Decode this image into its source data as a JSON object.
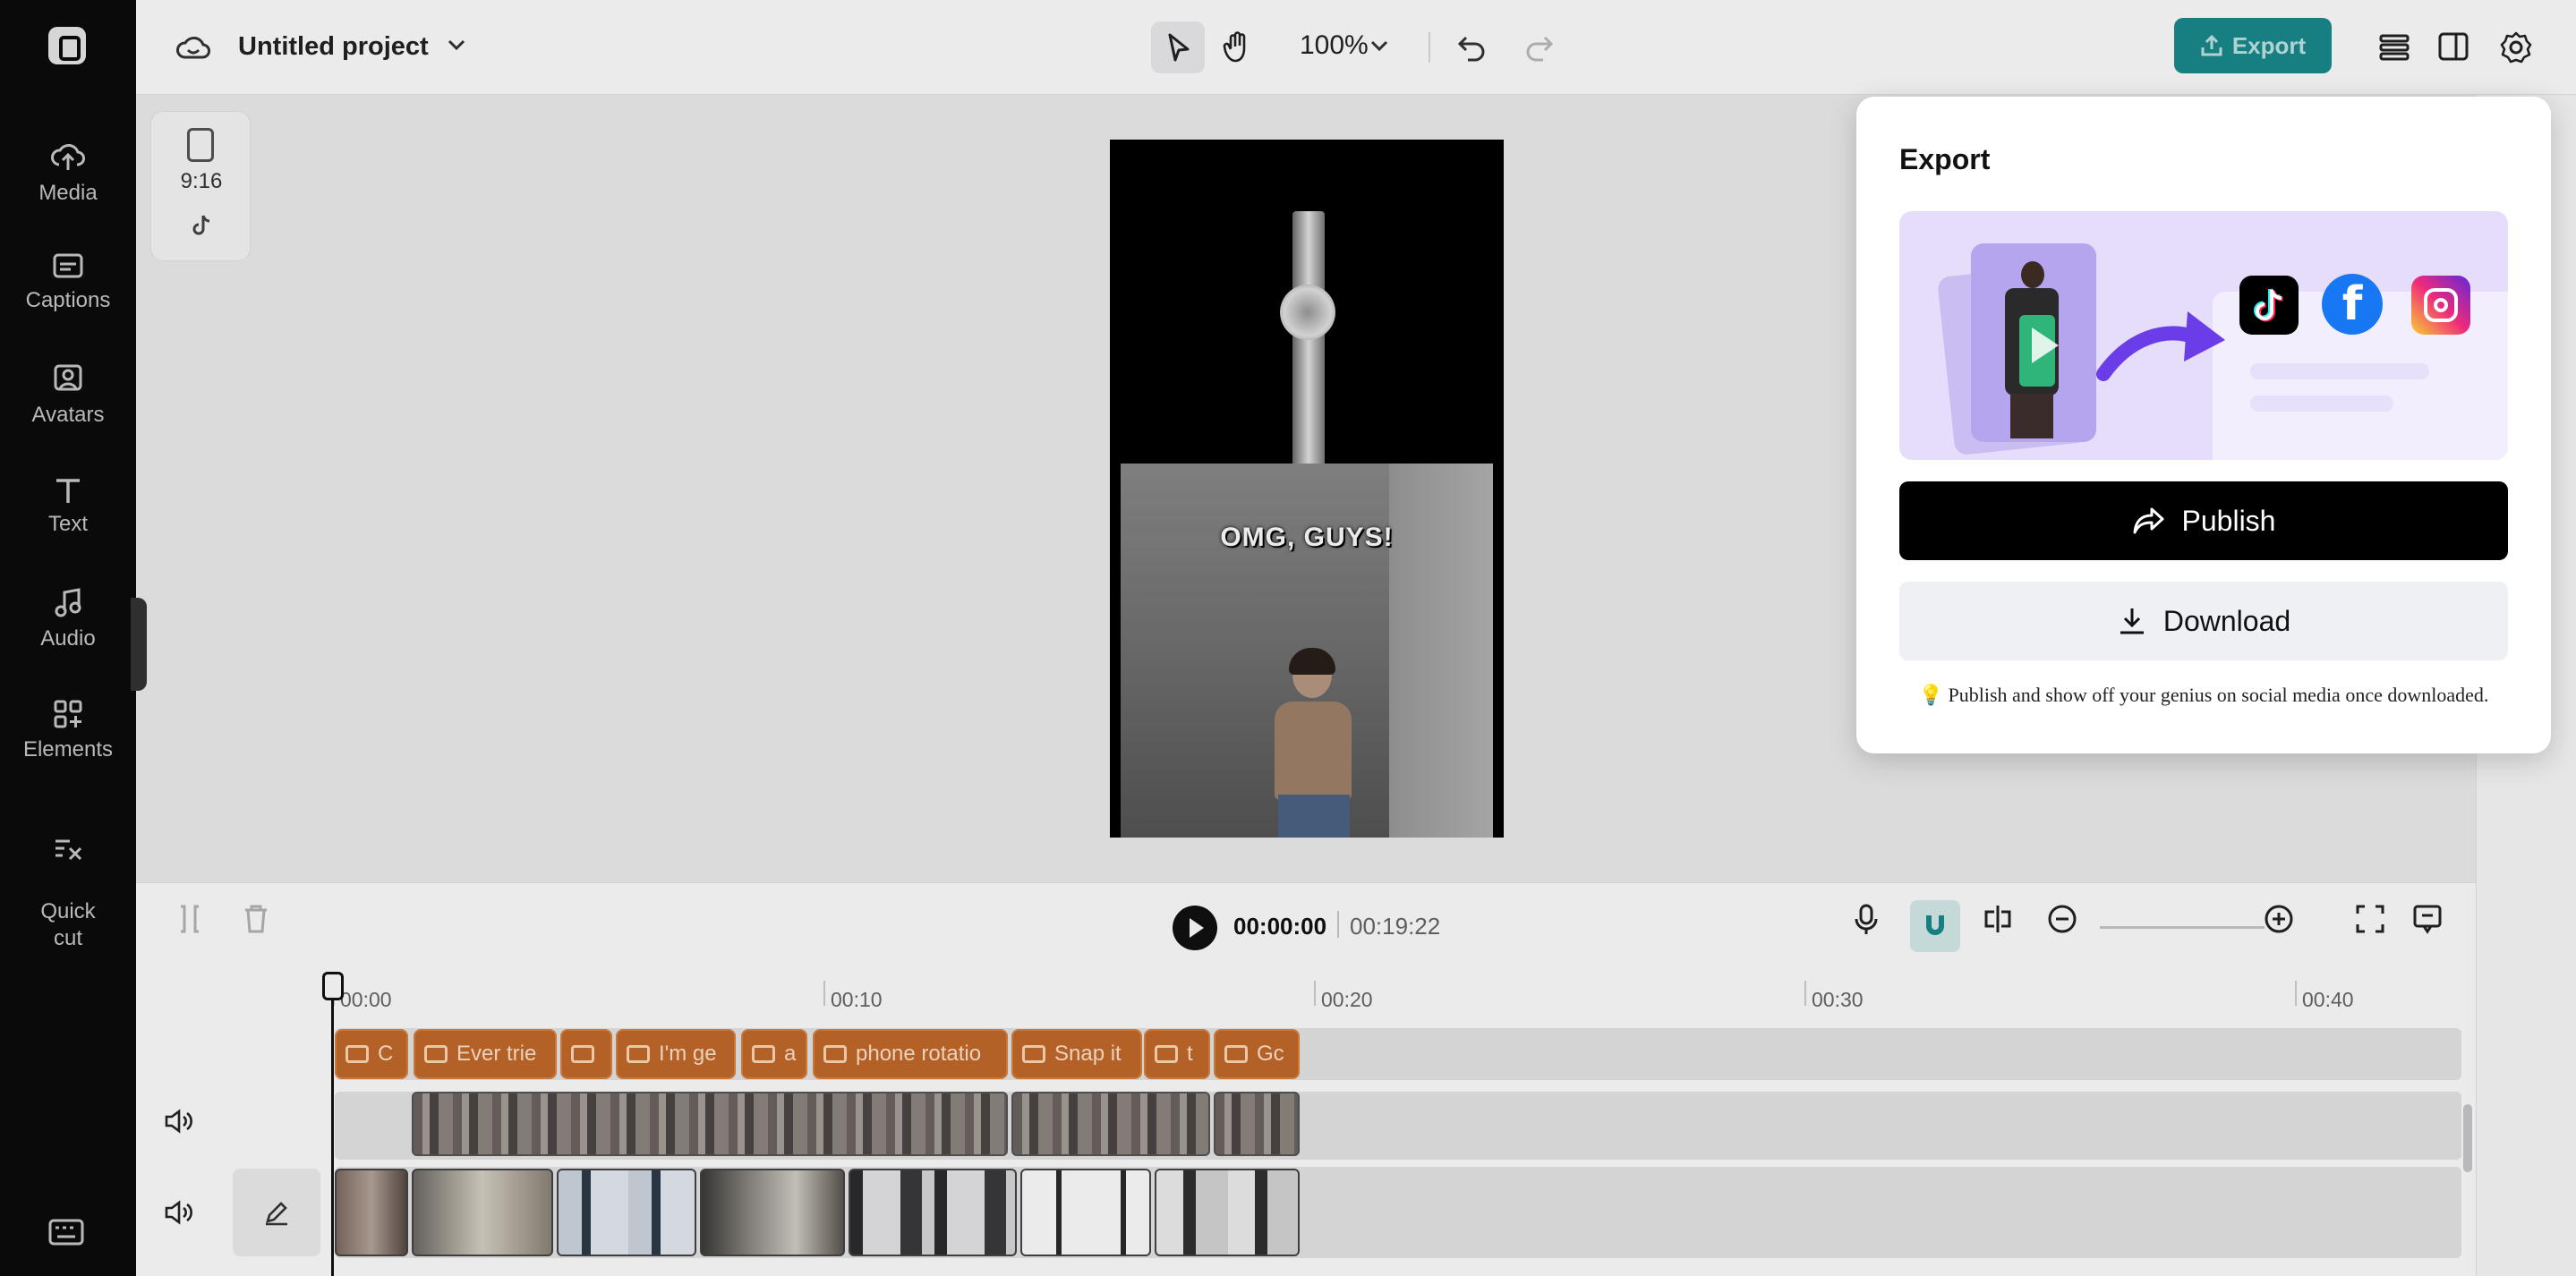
{
  "app": {
    "project_name": "Untitled project",
    "zoom_level": "100%"
  },
  "sidebar": {
    "items": [
      {
        "label": "Media",
        "icon": "cloud-upload-icon"
      },
      {
        "label": "Captions",
        "icon": "captions-icon"
      },
      {
        "label": "Avatars",
        "icon": "avatar-icon"
      },
      {
        "label": "Text",
        "icon": "text-icon"
      },
      {
        "label": "Audio",
        "icon": "music-note-icon"
      },
      {
        "label": "Elements",
        "icon": "elements-icon"
      },
      {
        "label": "Quick\ncut",
        "icon": "quick-cut-icon"
      }
    ]
  },
  "toolbar": {
    "export_label": "Export"
  },
  "canvas": {
    "aspect_ratio": "9:16",
    "caption_overlay": "OMG, GUYS!"
  },
  "playback": {
    "current_time": "00:00:00",
    "total_time": "00:19:22"
  },
  "timeline": {
    "ruler": [
      "00:00",
      "00:10",
      "00:20",
      "00:30",
      "00:40"
    ],
    "caption_clips": [
      "C",
      "Ever trie",
      "",
      "I'm ge",
      "a",
      "phone rotatio",
      "Snap it",
      "t",
      "Gc"
    ]
  },
  "export_popover": {
    "title": "Export",
    "publish_label": "Publish",
    "download_label": "Download",
    "note": "💡 Publish and show off your genius on social media once downloaded."
  },
  "colors": {
    "accent": "#1a8a8c",
    "caption_clip": "#c46a2b",
    "sidebar_bg": "#0b0b0c"
  }
}
